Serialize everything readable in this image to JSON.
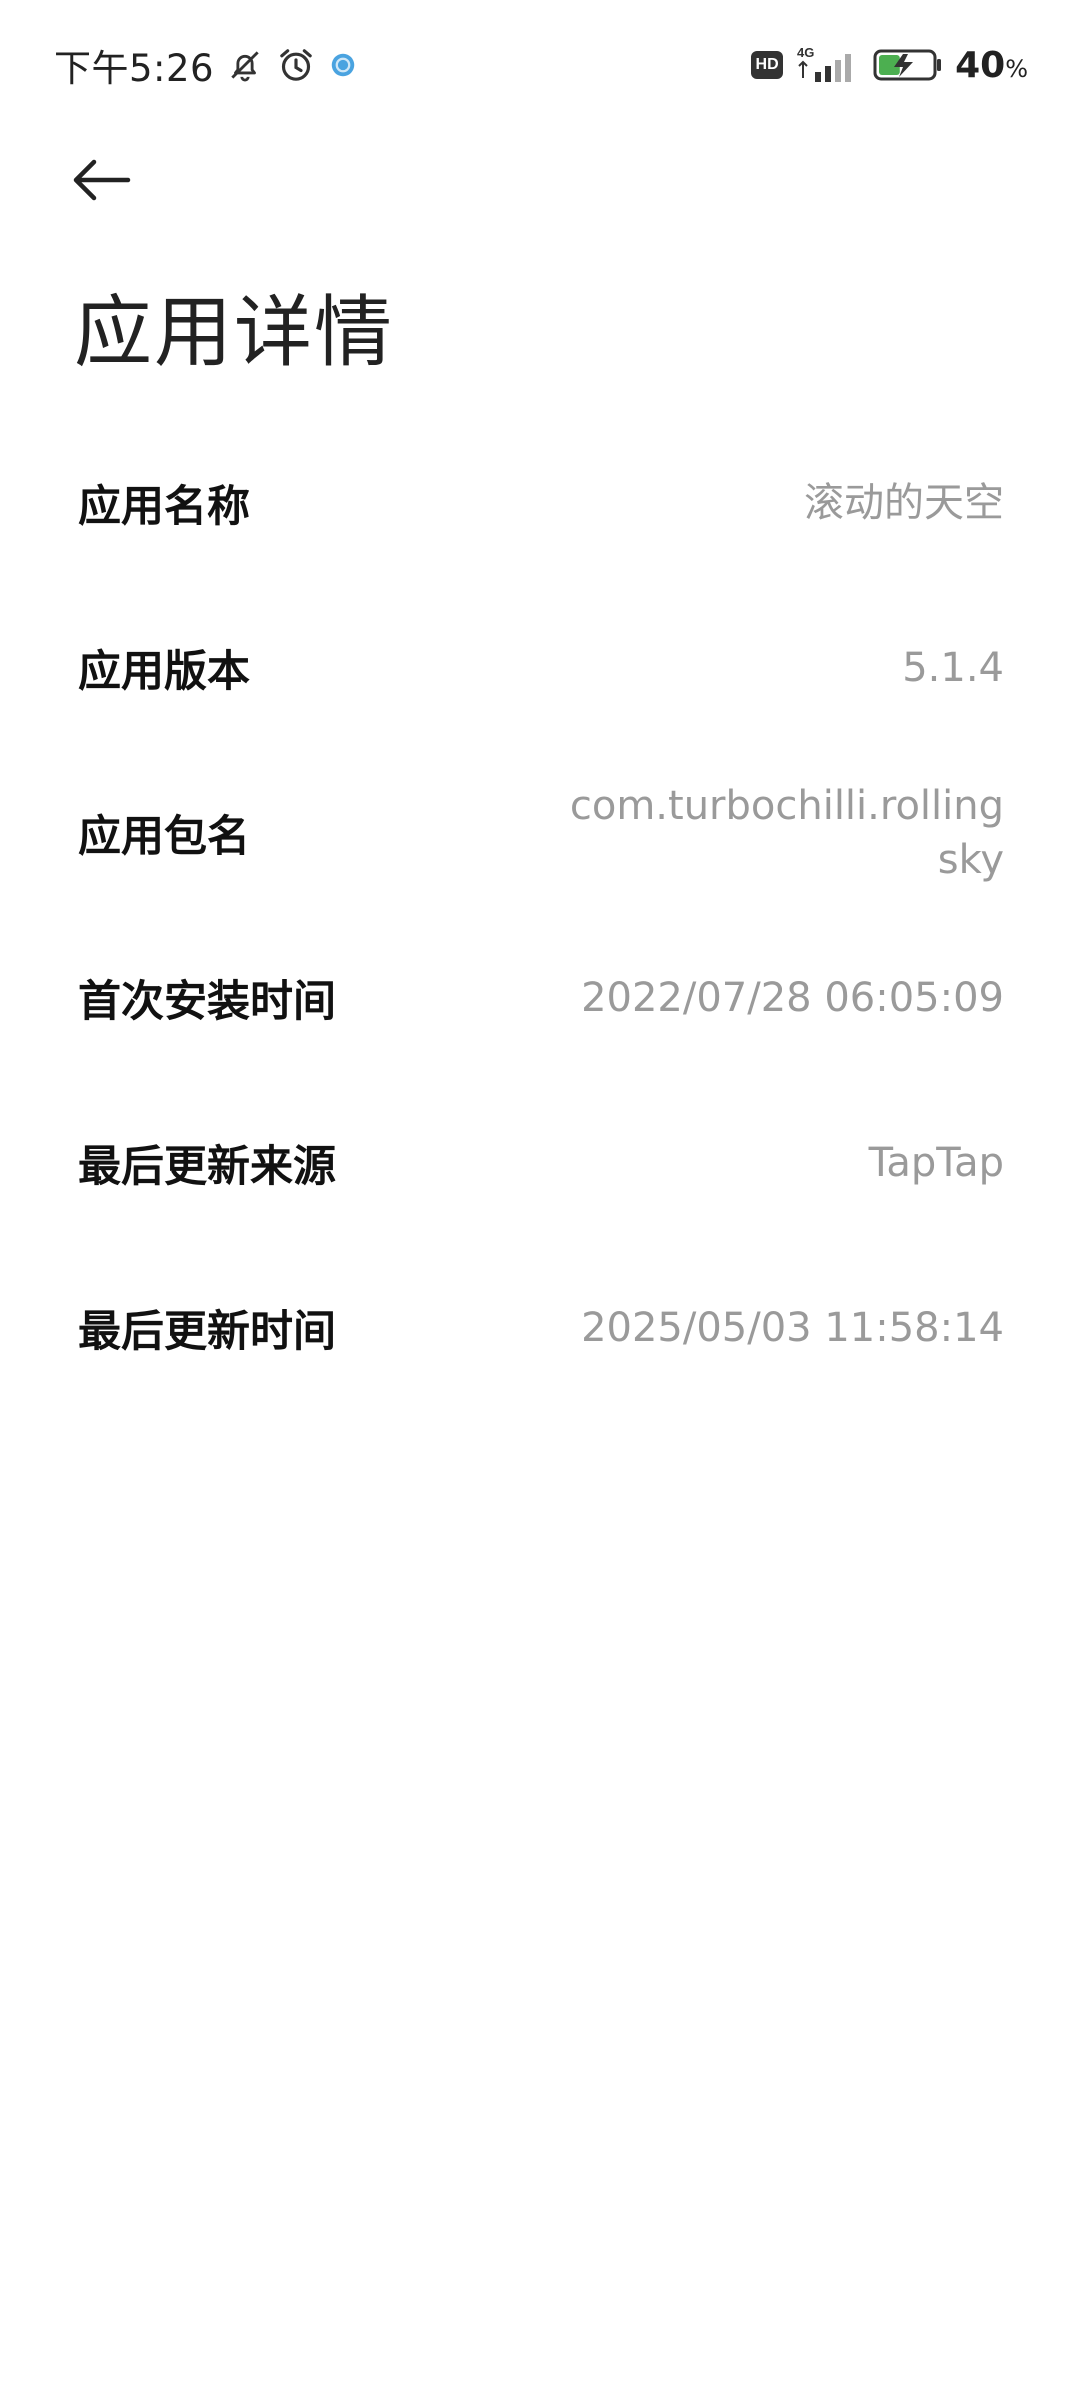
{
  "status_bar": {
    "time": "下午5:26",
    "network": "4G",
    "hd_label": "HD",
    "battery_value": "40",
    "battery_unit": "%",
    "icons": [
      "bell-off-icon",
      "alarm-icon",
      "app-notification-icon",
      "hd-icon",
      "signal-icon",
      "battery-charging-icon"
    ],
    "battery_level_percent": 40,
    "accent_color": "#4aa3e0"
  },
  "header": {
    "back_icon": "arrow-left-icon",
    "title": "应用详情"
  },
  "details": [
    {
      "label": "应用名称",
      "value": "滚动的天空"
    },
    {
      "label": "应用版本",
      "value": "5.1.4"
    },
    {
      "label": "应用包名",
      "value": "com.turbochilli.rollingsky"
    },
    {
      "label": "首次安装时间",
      "value": "2022/07/28 06:05:09"
    },
    {
      "label": "最后更新来源",
      "value": "TapTap"
    },
    {
      "label": "最后更新时间",
      "value": "2025/05/03 11:58:14"
    }
  ],
  "colors": {
    "label": "#111111",
    "value": "#9a9a9a",
    "background": "#ffffff"
  }
}
